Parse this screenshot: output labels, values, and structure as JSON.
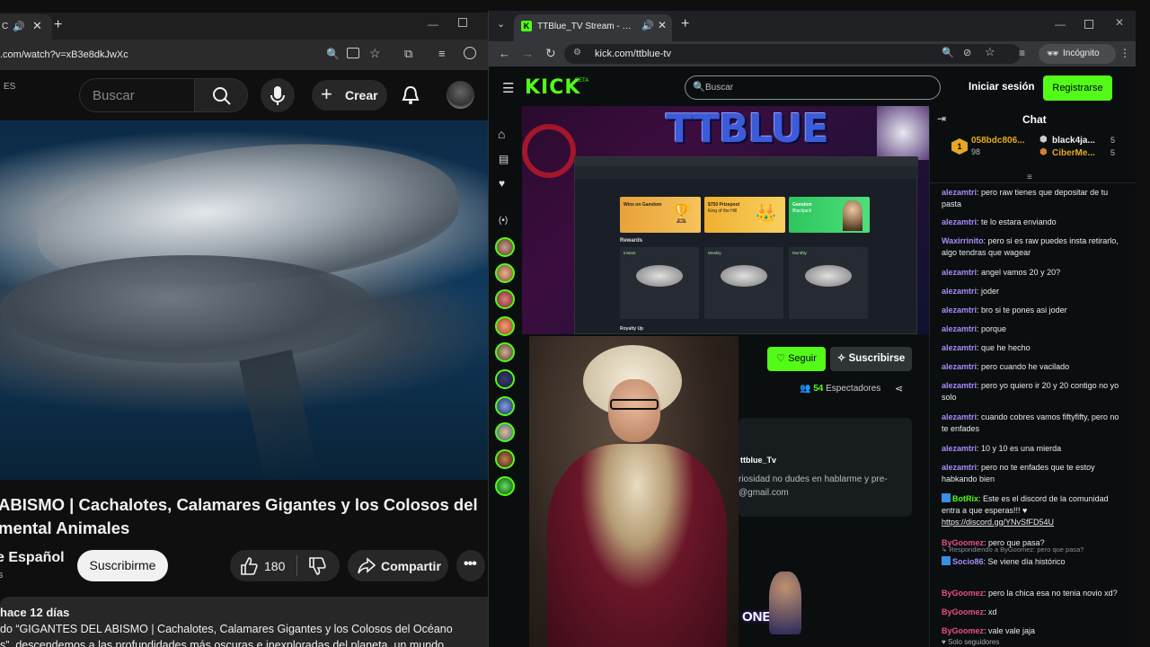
{
  "youtube": {
    "tab_title": "C",
    "url": ".com/watch?v=xB3e8dkJwXc",
    "country_code": "ES",
    "search_placeholder": "Buscar",
    "create_label": "Crear",
    "title_line1": "ABISMO | Cachalotes, Calamares Gigantes y los Colosos del",
    "title_line2": "mental Animales",
    "channel_name": "e Español",
    "channel_subs": "s",
    "subscribe_label": "Suscribirme",
    "like_count": "180",
    "share_label": "Compartir",
    "upload_age": "hace 12 días",
    "desc_line1": "do “GIGANTES DEL ABISMO | Cachalotes, Calamares Gigantes y los Colosos del Océano",
    "desc_line2": "s”, descendemos a las profundidades más oscuras e inexploradas del planeta, un mundo"
  },
  "kick": {
    "tab_title": "TTBlue_TV Stream - Watch l",
    "url": "kick.com/ttblue-tv",
    "incognito_label": "Incógnito",
    "logo_text": "KICK",
    "logo_badge": "BETA",
    "search_placeholder": "Buscar",
    "login_label": "Iniciar sesión",
    "register_label": "Registrarse",
    "follow_label": "Seguir",
    "subscribe_label": "Suscribirse",
    "viewers_count": "54",
    "viewers_label": "Espectadores",
    "about_name": "ttblue_Tv",
    "about_line1": "riosidad no dudes en hablarme y pre-",
    "about_line2": "@gmail.com",
    "banner_text": "TTBLUE",
    "bottom_banner_text": "ONES",
    "embedded_site": {
      "tile1_line1": "Wins on Gamdom",
      "tile2_line1": "$750 Prizepool",
      "tile2_line2": "King of the Hill",
      "tile3_line1": "Gamdom",
      "tile3_line2": "Blackjack",
      "rewards_label": "Rewards",
      "card1": "Instant",
      "card2": "Weekly",
      "card3": "Monthly",
      "royalty_label": "Royalty Up"
    },
    "chat": {
      "title": "Chat",
      "leaderboard": [
        {
          "name": "058bdc806...",
          "amount": "98"
        },
        {
          "name": "black4ja...",
          "amount": "5"
        },
        {
          "name": "CiberMe...",
          "amount": "5"
        }
      ],
      "messages": [
        {
          "user": "alezamtri",
          "text": "pero raw tienes que depositar de tu pasta",
          "color": "#a78bfa"
        },
        {
          "user": "alezamtri",
          "text": "te lo estara enviando",
          "color": "#a78bfa"
        },
        {
          "user": "Waxirrinito",
          "text": "pero si es raw puedes insta retirarlo, algo tendras que wagear",
          "color": "#a78bfa"
        },
        {
          "user": "alezamtri",
          "text": "angel vamos 20 y 20?",
          "color": "#a78bfa"
        },
        {
          "user": "alezamtri",
          "text": "joder",
          "color": "#a78bfa"
        },
        {
          "user": "alezamtri",
          "text": "bro si te pones asi joder",
          "color": "#a78bfa"
        },
        {
          "user": "alezamtri",
          "text": "porque",
          "color": "#a78bfa"
        },
        {
          "user": "alezamtri",
          "text": "que he hecho",
          "color": "#a78bfa"
        },
        {
          "user": "alezamtri",
          "text": "pero cuando he vacilado",
          "color": "#a78bfa"
        },
        {
          "user": "alezamtri",
          "text": "pero yo quiero ir 20 y 20 contigo no yo solo",
          "color": "#a78bfa"
        },
        {
          "user": "alezamtri",
          "text": "cuando cobres vamos fiftyfifty, pero no te enfades",
          "color": "#a78bfa"
        },
        {
          "user": "alezamtri",
          "text": "10 y 10 es una mierda",
          "color": "#a78bfa"
        },
        {
          "user": "alezamtri",
          "text": "pero no te enfades que te estoy habkando bien",
          "color": "#a78bfa"
        },
        {
          "user": "BotRix",
          "text": "Este es el discord de la comunidad entra a que esperas!!! ♥",
          "color": "#53fc18",
          "link": "https://discord.gg/YNvSfFD54U"
        },
        {
          "user": "ByGoomez",
          "text": "pero que pasa?",
          "color": "#e84c8a"
        },
        {
          "user": "Socio86",
          "text": "Se viene día histórico",
          "color": "#a78bfa",
          "reply": "Respondiendo a ByGoomez: pero que pasa?"
        },
        {
          "user": "ByGoomez",
          "text": "pero la chica esa no tenia novio xd?",
          "color": "#e84c8a"
        },
        {
          "user": "ByGoomez",
          "text": "xd",
          "color": "#e84c8a"
        },
        {
          "user": "ByGoomez",
          "text": "vale vale jaja",
          "color": "#e84c8a"
        }
      ],
      "footer": "Solo seguidores"
    }
  },
  "colors": {
    "kick_green": "#53fc18",
    "yt_bg": "#0f0f0f",
    "kick_bg": "#0b0e0f"
  }
}
